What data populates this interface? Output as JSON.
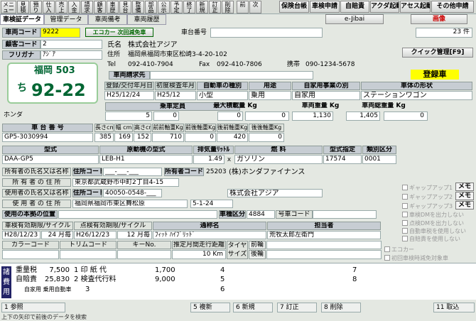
{
  "toolbar": {
    "items": [
      "メニュー",
      "見積",
      "預り",
      "仕入",
      "売上",
      "入金",
      "請求",
      "顧客",
      "車歴",
      "見台",
      "整備",
      "部品",
      "公示",
      "予定",
      "終了",
      "新規",
      "訂正",
      "削除",
      "前",
      "次"
    ],
    "right": [
      "保険台帳",
      "車検申請",
      "自賠責",
      "アクダ起動",
      "アセス起動",
      "その他申請"
    ]
  },
  "tabs": [
    "車検証データ",
    "管理データ",
    "車両備考",
    "車両履歴"
  ],
  "top": {
    "jibai": "e-Jibai",
    "gamen": "画像",
    "vehicle_code_label": "車両コード",
    "vehicle_code": "9222",
    "eco_car": "エコカー 次回減免車",
    "chassis_no_label": "車台番号",
    "count": "23 件"
  },
  "customer": {
    "code_label": "顧客コード",
    "code": "2",
    "kana_label": "フリガナ",
    "kana": "ｱｼﾞｱ",
    "name_label": "氏名",
    "name": "株式会社アジア",
    "addr_label": "住所",
    "addr": "福岡県福岡市東区松崎3-4-20-102",
    "tel_label": "Tel",
    "tel": "092-410-7904",
    "fax_label": "Fax",
    "fax": "092-410-7806",
    "mobile_label": "携帯",
    "mobile": "090-1234-5678",
    "quick": "クイック管理[F9]"
  },
  "plate": {
    "top": "福岡 503",
    "kana": "ち",
    "num": "92-22"
  },
  "billing_label": "車両請求先",
  "registered": "登録車",
  "reg": {
    "h": [
      "登録/交付年月日",
      "初度検査年月",
      "自動車の種別",
      "用途",
      "自家用事業の別",
      "車体の形状"
    ],
    "v": [
      "H25/12/24",
      "H25/12",
      "小型",
      "乗用",
      "自家用",
      "ステーションワゴン"
    ]
  },
  "maker": "ホンダ",
  "capacity": {
    "h": [
      "乗車定員",
      "最大積載量 Kg",
      "車両重量 Kg",
      "車両総重量 Kg"
    ],
    "cap": "5",
    "cap2": "0",
    "load": "0",
    "load2": "0",
    "weight": "1,130",
    "gross": "1,405",
    "gross2": "0"
  },
  "dims": {
    "chassis_h": "車 台 番 号",
    "h": [
      "長さcm",
      "幅 cm",
      "高さcm",
      "前前軸重Kg",
      "前後軸重Kg",
      "後前軸重Kg",
      "後後軸重Kg"
    ],
    "chassis": "GP5-3030994",
    "v": [
      "385",
      "169",
      "152",
      "710",
      "0",
      "420",
      "0"
    ]
  },
  "engine": {
    "h": [
      "型式",
      "原動機の型式",
      "排気量ﾘｯﾄﾙ",
      "燃 料",
      "型式指定",
      "類別区分"
    ],
    "model": "DAA-GP5",
    "engine": "LEB-H1",
    "disp": "1.49",
    "disp_unit": "ｘ",
    "fuel": "ガソリン",
    "type": "17574",
    "cls": "0001"
  },
  "owner": {
    "name_label": "所有者の氏名又は名称",
    "addr_code_label": "住所コード",
    "code": "___-___-___",
    "ocode_label": "所有者コード",
    "ocode": "25203",
    "name": "(株)ホンダファイナンス",
    "addr_label": "所 有 者 の 住 所",
    "addr": "東京都武蔵野市中町2丁目4-15"
  },
  "user": {
    "name_label": "使用者の氏名又は名称",
    "code_label": "住所コード",
    "code": "40050-0548-___",
    "name": "株式会社アジア",
    "addr_label": "使 用 者 の 住 所",
    "addr": "福岡県福岡市東区舞松原",
    "addr2": "5-1-24"
  },
  "base": {
    "label": "使用の本拠の位置",
    "kind_label": "車種区分",
    "kind": "4884",
    "no_label": "号車コード"
  },
  "checks": [
    "ギャップアップ1",
    "ギャップアップ2",
    "ギャップアップ3",
    "車検DMを出力しない",
    "点検DMを出力しない",
    "自動車税を使用しない",
    "自賠責を使用しない",
    "エコカー",
    "初回車検時減免対象車"
  ],
  "memo": [
    "メモ",
    "メモ",
    "メモ"
  ],
  "expiry": {
    "h1": "車検有効期限/サイクル",
    "h2": "点検有効期限/サイクル",
    "h3": "通称名",
    "h4": "担当者",
    "date1": "H28/12/23",
    "cyc1": "24 月毎",
    "date2": "H26/12/23",
    "cyc2": "12 月毎",
    "nick": "ﾌｨｯﾄ ﾊｲﾌﾞﾘｯﾄﾞ",
    "staff": "荒牧太郎左衛門"
  },
  "codes": {
    "h": [
      "カラーコード",
      "トリムコード",
      "キーNo.",
      "推定月間走行距離",
      "タイヤサイズ"
    ],
    "km": "10 Km",
    "front": "前輪",
    "rear": "後輪"
  },
  "cost": {
    "side": "諸費用",
    "r1l": "重量税",
    "r1v": "7,500",
    "r2l": "自賠責",
    "r2v": "25,830",
    "r3l": "自家用 乗用自動車",
    "i1": "1 印 紙 代",
    "i1v": "1,700",
    "i2": "2 検査代行料",
    "i2v": "9,000",
    "n1": "3",
    "n2": "4",
    "n3": "5",
    "n4": "6",
    "n5": "7",
    "n6": "8"
  },
  "fkeys": [
    "1 参照",
    "5 複新",
    "6 新規",
    "7 訂正",
    "8 削除",
    "11 取込"
  ],
  "status": "上下の矢印で前後のデータを検索"
}
